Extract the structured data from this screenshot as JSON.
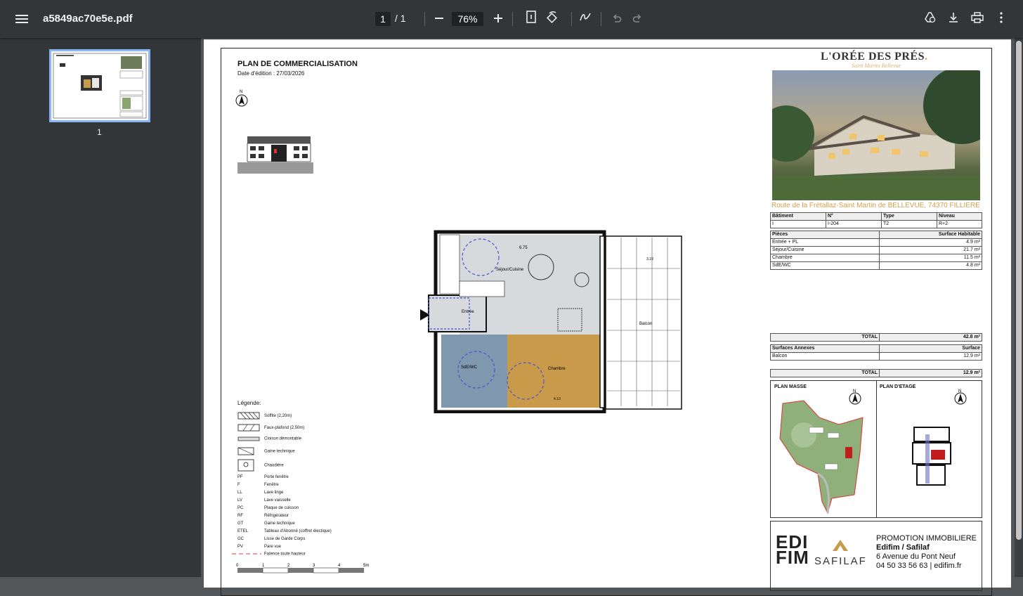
{
  "toolbar": {
    "filename": "a5849ac70e5e.pdf",
    "current_page": "1",
    "page_total": "1",
    "zoom": "76%"
  },
  "sidebar": {
    "thumbnail_label": "1"
  },
  "doc": {
    "title": "PLAN DE COMMERCIALISATION",
    "date": "Date d'édition :  27/03/2026",
    "brand": "L'ORÉE DES PRÉS",
    "brand_dot": ".",
    "brand_sub": "Saint Martin Bellevue",
    "address": "Route de la Frétallaz-Saint Martin de BELLEVUE, 74370 FILLIERE",
    "lot": {
      "headers": [
        "Bâtiment",
        "N°",
        "Type",
        "Niveau"
      ],
      "values": [
        "I",
        "I-204",
        "T2",
        "R+2"
      ]
    },
    "rooms_header": [
      "Pièces",
      "Surface Habitable"
    ],
    "rooms": [
      [
        "Entrée + PL",
        "4.9 m²"
      ],
      [
        "Séjour/Cuisine",
        "21.7 m²"
      ],
      [
        "Chambre",
        "11.5 m²"
      ],
      [
        "SdE/WC",
        "4.8 m²"
      ]
    ],
    "total_label": "TOTAL",
    "total_habitable": "42.8 m²",
    "annex_header": [
      "Surfaces Annexes",
      "Surface"
    ],
    "annex": [
      [
        "Balcon",
        "12.9 m²"
      ]
    ],
    "total_annex": "12.9 m²",
    "plan_masse": "PLAN MASSE",
    "plan_etage": "PLAN D'ETAGE",
    "north": "N",
    "rooms_labels": {
      "sejour": "Séjour/Cuisine",
      "entree": "Entrée",
      "chambre": "Chambre",
      "sde": "SdE/WC",
      "balcon": "Balcon",
      "dim_675": "6.75",
      "dim_319": "3.19",
      "dim_413": "4.13"
    },
    "legend_title": "Légende:",
    "legend": [
      [
        "",
        "Soffite (2,20m)"
      ],
      [
        "",
        "Faux-plafond (2,50m)"
      ],
      [
        "",
        "Cloison démontable"
      ],
      [
        "",
        "Gaine technique"
      ],
      [
        "",
        "Chaudière"
      ],
      [
        "PF",
        "Porte fenêtre"
      ],
      [
        "F",
        "Fenêtre"
      ],
      [
        "LL",
        "Lave linge"
      ],
      [
        "LV",
        "Lave vaisselle"
      ],
      [
        "PC",
        "Plaque de cuisson"
      ],
      [
        "RF",
        "Réfrigérateur"
      ],
      [
        "GT",
        "Gaine technique"
      ],
      [
        "ETEL",
        "Tableau d'Abonné (coffret électique)"
      ],
      [
        "GC",
        "Lisse de Garde Corps"
      ],
      [
        "PV",
        "Pare vue"
      ],
      [
        "",
        "Faïence toute hauteur"
      ]
    ],
    "scale": [
      "0",
      "1",
      "2",
      "3",
      "4",
      "5m"
    ],
    "promo": {
      "line1": "PROMOTION IMMOBILIERE",
      "line2": "Edifim / Safilaf",
      "line3": "6 Avenue du Pont Neuf",
      "line4": "04 50 33 56 63 | edifim.fr",
      "logo1": "EDI FIM",
      "logo2": "SAFILAF"
    }
  }
}
